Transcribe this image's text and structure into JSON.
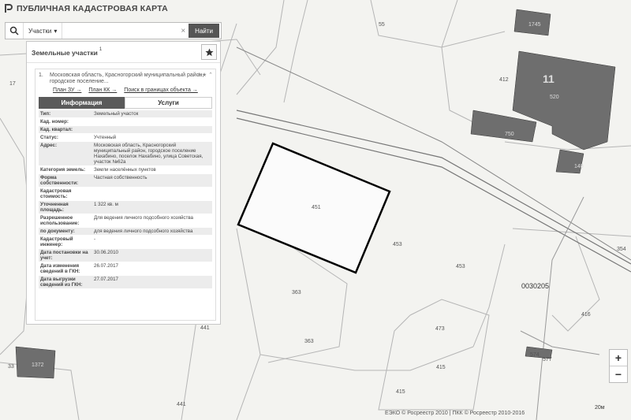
{
  "app": {
    "title": "ПУБЛИЧНАЯ КАДАСТРОВАЯ КАРТА"
  },
  "search": {
    "type": "Участки",
    "placeholder": "",
    "button": "Найти"
  },
  "panel": {
    "title": "Земельные участки",
    "count": "1",
    "result": {
      "number": "1.",
      "address": "Московская область, Красногорский муниципальный район, городское поселение...",
      "links": [
        "План ЗУ →",
        "План КК →",
        "Поиск в границах объекта →"
      ]
    },
    "tabs": [
      "Информация",
      "Услуги"
    ],
    "rows": [
      {
        "key": "Тип:",
        "value": "Земельный участок"
      },
      {
        "key": "Кад. номер:",
        "value": ""
      },
      {
        "key": "Кад. квартал:",
        "value": ""
      },
      {
        "key": "Статус:",
        "value": "Учтенный"
      },
      {
        "key": "Адрес:",
        "value": "Московская область, Красногорский муниципальный район, городское поселение Нахабино, поселок Нахабино, улица Советская, участок №62а"
      },
      {
        "key": "Категория земель:",
        "value": "Земли населённых пунктов"
      },
      {
        "key": "Форма собственности:",
        "value": "Частная собственность"
      },
      {
        "key": "Кадастровая стоимость:",
        "value": ""
      },
      {
        "key": "Уточненная площадь:",
        "value": "1 322 кв. м"
      },
      {
        "key": "Разрешенное использование:",
        "value": "Для ведения личного подсобного хозяйства"
      },
      {
        "key": "по документу:",
        "value": "для ведения личного подсобного хозяйства"
      },
      {
        "key": "Кадастровый инженер:",
        "value": "-"
      },
      {
        "key": "Дата постановки на учет:",
        "value": "30.06.2010"
      },
      {
        "key": "Дата изменения сведений в ГКН:",
        "value": "26.07.2017"
      },
      {
        "key": "Дата выгрузки сведений из ГКН:",
        "value": "27.07.2017"
      }
    ]
  },
  "map": {
    "labels": [
      "55",
      "17",
      "412",
      "11",
      "520",
      "750",
      "140",
      "451",
      "453",
      "453",
      "0030205",
      "354",
      "363",
      "363",
      "441",
      "473",
      "415",
      "415",
      "416",
      "574",
      "577",
      "441",
      "33",
      "1372",
      "1745"
    ],
    "scale": "20м",
    "attribution": "ЕЭКО © Росреестр 2010 | ПКК © Росреестр 2010-2016"
  },
  "zoom": {
    "in": "+",
    "out": "−"
  },
  "colors": {
    "building": "#6e6e6e",
    "boundary": "#000000",
    "header_button": "#555555"
  }
}
